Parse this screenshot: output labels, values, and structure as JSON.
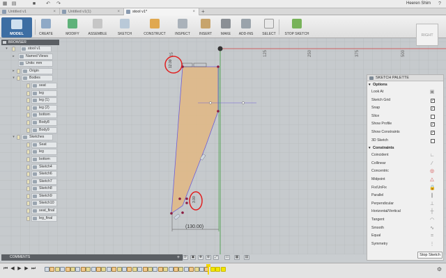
{
  "user": {
    "name": "Heeren Shim"
  },
  "titlebar_icons": [
    "app-menu-icon",
    "file-icon",
    "save-icon",
    "undo-icon",
    "redo-icon"
  ],
  "tabs": [
    {
      "label": "Untitled v1",
      "active": false
    },
    {
      "label": "Untitled v1(1)",
      "active": false
    },
    {
      "label": "stool v1*",
      "active": true
    }
  ],
  "toolbar": {
    "workspace": "MODEL",
    "tools": [
      {
        "name": "create",
        "label": "CREATE"
      },
      {
        "name": "modify",
        "label": "MODIFY"
      },
      {
        "name": "assemble",
        "label": "ASSEMBLE"
      },
      {
        "name": "sketch",
        "label": "SKETCH"
      },
      {
        "name": "construct",
        "label": "CONSTRUCT"
      },
      {
        "name": "inspect",
        "label": "INSPECT"
      },
      {
        "name": "insert",
        "label": "INSERT"
      },
      {
        "name": "make",
        "label": "MAKE"
      },
      {
        "name": "add-ins",
        "label": "ADD-INS"
      },
      {
        "name": "select",
        "label": "SELECT"
      },
      {
        "name": "stop-sketch",
        "label": "STOP SKETCH"
      }
    ]
  },
  "viewcube": {
    "label": "RIGHT"
  },
  "browser": {
    "title": "BROWSER",
    "root": "stool v1",
    "items": [
      {
        "label": "Named Views",
        "kind": "folder"
      },
      {
        "label": "Units: mm",
        "kind": "units"
      },
      {
        "label": "Origin",
        "kind": "folder"
      },
      {
        "label": "Bodies",
        "kind": "folder"
      }
    ],
    "bodies": [
      "seat",
      "leg",
      "leg (1)",
      "leg (2)",
      "bottom",
      "Body8",
      "Body9"
    ],
    "sketches_label": "Sketches",
    "sketches": [
      "Seat",
      "leg",
      "bottom",
      "Sketch4",
      "Sketch6",
      "Sketch7",
      "Sketch8",
      "Sketch9",
      "Sketch10",
      "seat_final",
      "leg_final"
    ]
  },
  "ruler_labels": [
    "25",
    "125",
    "250",
    "375",
    "500"
  ],
  "sketch": {
    "dimension_label": "(130.00)",
    "fill_color": "#e1b783",
    "line_color": "#6f5fd6",
    "point_color": "#8a1a40",
    "highlight_color": "#e02020",
    "small_dim_top": "12.00",
    "small_dim_bottom": "3.00"
  },
  "palette": {
    "title": "SKETCH PALETTE",
    "options_header": "Options",
    "options": [
      {
        "label": "Look At",
        "checked": null
      },
      {
        "label": "Sketch Grid",
        "checked": true
      },
      {
        "label": "Snap",
        "checked": true
      },
      {
        "label": "Slice",
        "checked": false
      },
      {
        "label": "Show Profile",
        "checked": true
      },
      {
        "label": "Show Constraints",
        "checked": true
      },
      {
        "label": "3D Sketch",
        "checked": false
      }
    ],
    "constraints_header": "Constraints",
    "constraints": [
      {
        "label": "Coincident",
        "icon": "coincident-icon"
      },
      {
        "label": "Collinear",
        "icon": "collinear-icon"
      },
      {
        "label": "Concentric",
        "icon": "concentric-icon"
      },
      {
        "label": "Midpoint",
        "icon": "midpoint-icon"
      },
      {
        "label": "Fix/UnFix",
        "icon": "lock-icon"
      },
      {
        "label": "Parallel",
        "icon": "parallel-icon"
      },
      {
        "label": "Perpendicular",
        "icon": "perpendicular-icon"
      },
      {
        "label": "Horizontal/Vertical",
        "icon": "horizontal-vertical-icon"
      },
      {
        "label": "Tangent",
        "icon": "tangent-icon"
      },
      {
        "label": "Smooth",
        "icon": "smooth-icon"
      },
      {
        "label": "Equal",
        "icon": "equal-icon"
      },
      {
        "label": "Symmetry",
        "icon": "symmetry-icon"
      }
    ],
    "stop_label": "Stop Sketch"
  },
  "comments": {
    "label": "COMMENTS"
  }
}
